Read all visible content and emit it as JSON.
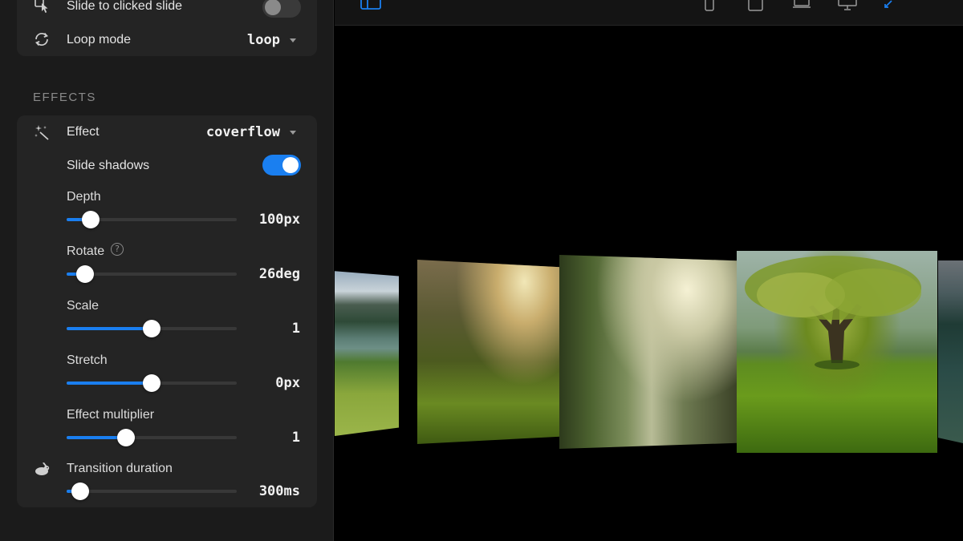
{
  "sidebar": {
    "slide_to_clicked": {
      "label": "Slide to clicked slide",
      "enabled": false
    },
    "loop_mode": {
      "label": "Loop mode",
      "value": "loop"
    },
    "effects_section_title": "EFFECTS",
    "effect": {
      "label": "Effect",
      "value": "coverflow"
    },
    "slide_shadows": {
      "label": "Slide shadows",
      "enabled": true
    },
    "depth": {
      "label": "Depth",
      "value": "100px",
      "fraction": 0.14
    },
    "rotate": {
      "label": "Rotate",
      "value": "26deg",
      "fraction": 0.11,
      "help_glyph": "?"
    },
    "scale": {
      "label": "Scale",
      "value": "1",
      "fraction": 0.5
    },
    "stretch": {
      "label": "Stretch",
      "value": "0px",
      "fraction": 0.5
    },
    "effect_multiplier": {
      "label": "Effect multiplier",
      "value": "1",
      "fraction": 0.35
    },
    "transition_duration": {
      "label": "Transition duration",
      "value": "300ms",
      "fraction": 0.08
    }
  },
  "toolbar": {
    "icons": [
      "layout-toggle-icon",
      "phone-icon",
      "tablet-icon",
      "laptop-icon",
      "desktop-icon",
      "fullscreen-icon"
    ]
  },
  "colors": {
    "accent": "#1a7ff0",
    "panel_bg": "#1b1b1b",
    "card_bg": "#242424",
    "preview_bg": "#000000"
  }
}
